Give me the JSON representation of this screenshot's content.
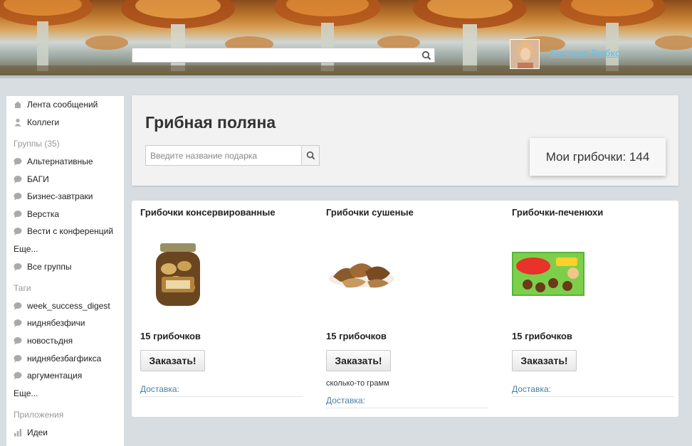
{
  "header": {
    "search": {
      "value": "",
      "placeholder": "",
      "icon": "search-icon"
    },
    "user": {
      "name": "Евгения Любко",
      "link_color": "#6fc2e8"
    }
  },
  "sidebar": {
    "top_items": [
      {
        "label": "Лента сообщений",
        "icon": "home-icon"
      },
      {
        "label": "Коллеги",
        "icon": "person-icon"
      }
    ],
    "groups_label": "Группы (35)",
    "groups": [
      {
        "label": "Альтернативные",
        "icon": "chat-bubble-icon"
      },
      {
        "label": "БАГИ",
        "icon": "chat-bubble-icon"
      },
      {
        "label": "Бизнес-завтраки",
        "icon": "chat-bubble-icon"
      },
      {
        "label": "Верстка",
        "icon": "chat-bubble-icon"
      },
      {
        "label": "Вести с конференций",
        "icon": "chat-bubble-icon"
      }
    ],
    "groups_more": "Еще...",
    "all_groups": {
      "label": "Все группы",
      "icon": "chat-bubble-icon"
    },
    "tags_label": "Таги",
    "tags": [
      {
        "label": "week_success_digest",
        "icon": "chat-bubble-icon"
      },
      {
        "label": "ниднябезфичи",
        "icon": "chat-bubble-icon"
      },
      {
        "label": "новостьдня",
        "icon": "chat-bubble-icon"
      },
      {
        "label": "ниднябезбагфикса",
        "icon": "chat-bubble-icon"
      },
      {
        "label": "аргументация",
        "icon": "chat-bubble-icon"
      }
    ],
    "tags_more": "Еще...",
    "apps_label": "Приложения",
    "apps": [
      {
        "label": "Идеи",
        "icon": "bar-chart-icon"
      }
    ]
  },
  "main": {
    "title": "Грибная поляна",
    "gift_search": {
      "value": "",
      "placeholder": "Введите название подарка",
      "icon": "search-icon"
    },
    "balance": "Мои грибочки: 144",
    "products": [
      {
        "name": "Грибочки консервированные",
        "price": "15 грибочков",
        "button": "Заказать!",
        "note": "",
        "delivery": "Доставка:",
        "image": "mushroom-jar"
      },
      {
        "name": "Грибочки сушеные",
        "price": "15 грибочков",
        "button": "Заказать!",
        "note": "сколько-то грамм",
        "delivery": "Доставка:",
        "image": "dried-mushrooms"
      },
      {
        "name": "Грибочки-печенюхи",
        "price": "15 грибочков",
        "button": "Заказать!",
        "note": "",
        "delivery": "Доставка:",
        "image": "choco-boy-box"
      }
    ]
  },
  "colors": {
    "accent_link": "#4a7fa8",
    "page_bg": "#d7dde1"
  }
}
